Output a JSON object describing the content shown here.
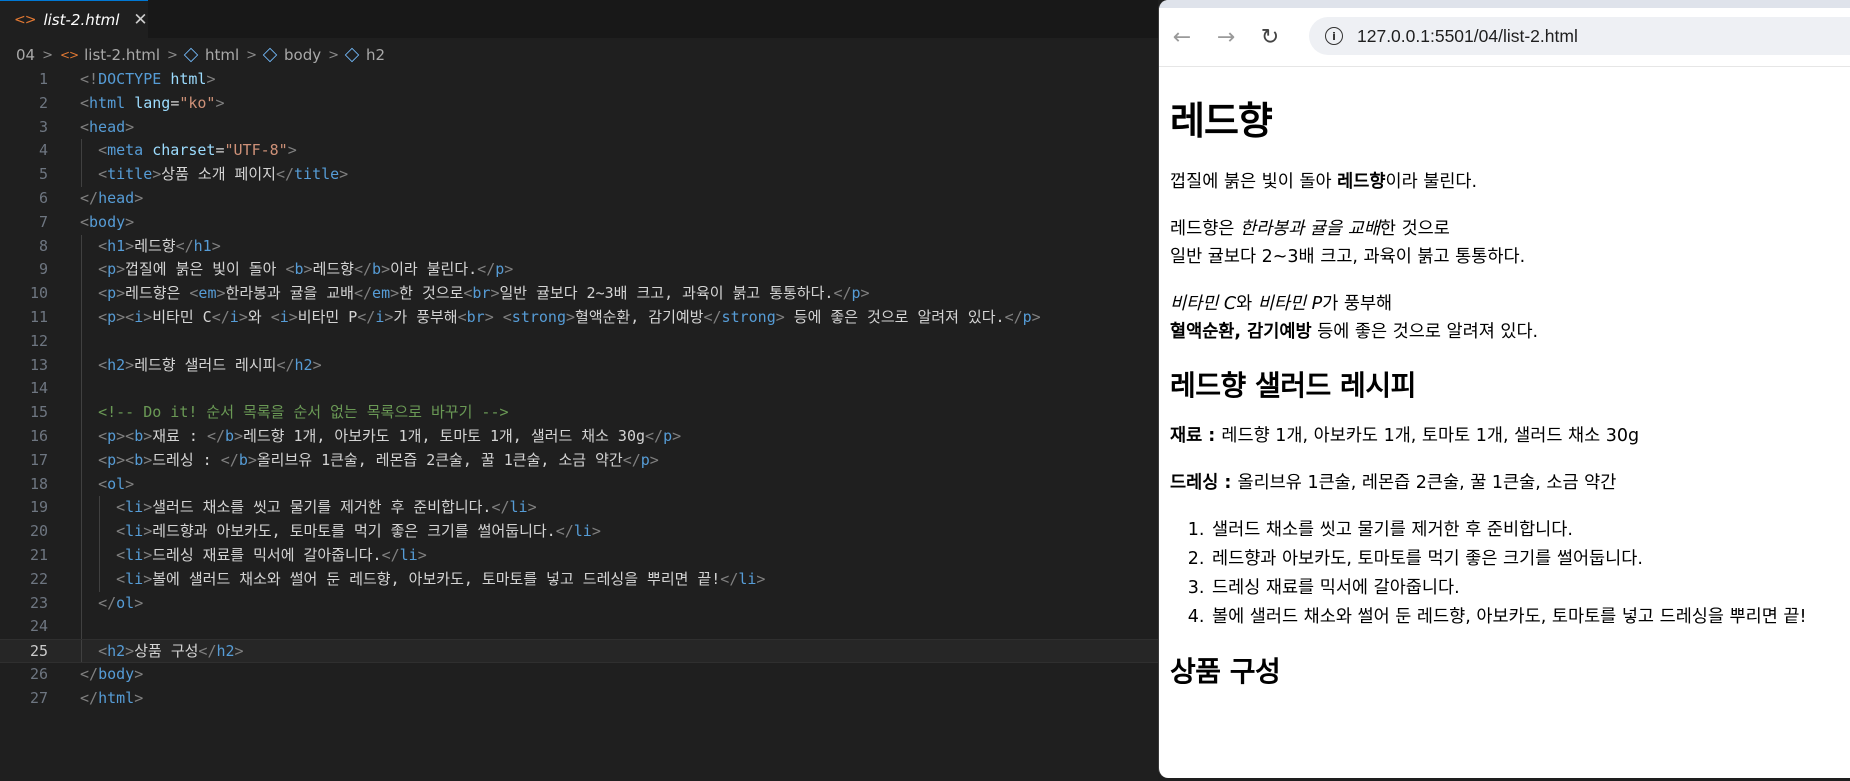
{
  "editor": {
    "tab_icon": "<>",
    "tab_title": "list-2.html",
    "tab_close": "✕",
    "breadcrumb": [
      "04",
      "list-2.html",
      "html",
      "body",
      "h2"
    ],
    "current_line": 25
  },
  "browser": {
    "url": "127.0.0.1:5501/04/list-2.html"
  },
  "page": {
    "h1": "레드향",
    "p1": {
      "a": "껍질에 붉은 빛이 돌아 ",
      "b": "레드향",
      "c": "이라 불린다."
    },
    "p2": {
      "a": "레드향은 ",
      "em": "한라봉과 귤을 교배",
      "b": "한 것으로",
      "c": "일반 귤보다 2~3배 크고, 과육이 붉고 통통하다."
    },
    "p3": {
      "i1": "비타민 C",
      "a": "와 ",
      "i2": "비타민 P",
      "b": "가 풍부해",
      "strong": "혈액순환, 감기예방",
      "c": " 등에 좋은 것으로 알려져 있다."
    },
    "h2_recipe": "레드향 샐러드 레시피",
    "p4": {
      "b": "재료 : ",
      "t": "레드향 1개, 아보카도 1개, 토마토 1개, 샐러드 채소 30g"
    },
    "p5": {
      "b": "드레싱 : ",
      "t": "올리브유 1큰술, 레몬즙 2큰술, 꿀 1큰술, 소금 약간"
    },
    "steps": [
      "샐러드 채소를 씻고 물기를 제거한 후 준비합니다.",
      "레드향과 아보카도, 토마토를 먹기 좋은 크기를 썰어둡니다.",
      "드레싱 재료를 믹서에 갈아줍니다.",
      "볼에 샐러드 채소와 썰어 둔 레드향, 아보카도, 토마토를 넣고 드레싱을 뿌리면 끝!"
    ],
    "h2_composition": "상품 구성"
  },
  "code_lines": [
    [
      [
        "tg",
        "<!"
      ],
      [
        "tn",
        "DOCTYPE"
      ],
      [
        "tx",
        " "
      ],
      [
        "an",
        "html"
      ],
      [
        "tg",
        ">"
      ]
    ],
    [
      [
        "tg",
        "<"
      ],
      [
        "tn",
        "html"
      ],
      [
        "tx",
        " "
      ],
      [
        "an",
        "lang"
      ],
      [
        "tx",
        "="
      ],
      [
        "av",
        "\"ko\""
      ],
      [
        "tg",
        ">"
      ]
    ],
    [
      [
        "tg",
        "<"
      ],
      [
        "tn",
        "head"
      ],
      [
        "tg",
        ">"
      ]
    ],
    [
      [
        "tx",
        "  "
      ],
      [
        "tg",
        "<"
      ],
      [
        "tn",
        "meta"
      ],
      [
        "tx",
        " "
      ],
      [
        "an",
        "charset"
      ],
      [
        "tx",
        "="
      ],
      [
        "av",
        "\"UTF-8\""
      ],
      [
        "tg",
        ">"
      ]
    ],
    [
      [
        "tx",
        "  "
      ],
      [
        "tg",
        "<"
      ],
      [
        "tn",
        "title"
      ],
      [
        "tg",
        ">"
      ],
      [
        "tx",
        "상품 소개 페이지"
      ],
      [
        "tg",
        "</"
      ],
      [
        "tn",
        "title"
      ],
      [
        "tg",
        ">"
      ]
    ],
    [
      [
        "tg",
        "</"
      ],
      [
        "tn",
        "head"
      ],
      [
        "tg",
        ">"
      ]
    ],
    [
      [
        "tg",
        "<"
      ],
      [
        "tn",
        "body"
      ],
      [
        "tg",
        ">"
      ]
    ],
    [
      [
        "tx",
        "  "
      ],
      [
        "tg",
        "<"
      ],
      [
        "tn",
        "h1"
      ],
      [
        "tg",
        ">"
      ],
      [
        "tx",
        "레드향"
      ],
      [
        "tg",
        "</"
      ],
      [
        "tn",
        "h1"
      ],
      [
        "tg",
        ">"
      ]
    ],
    [
      [
        "tx",
        "  "
      ],
      [
        "tg",
        "<"
      ],
      [
        "tn",
        "p"
      ],
      [
        "tg",
        ">"
      ],
      [
        "tx",
        "껍질에 붉은 빛이 돌아 "
      ],
      [
        "tg",
        "<"
      ],
      [
        "tn",
        "b"
      ],
      [
        "tg",
        ">"
      ],
      [
        "tx",
        "레드향"
      ],
      [
        "tg",
        "</"
      ],
      [
        "tn",
        "b"
      ],
      [
        "tg",
        ">"
      ],
      [
        "tx",
        "이라 불린다."
      ],
      [
        "tg",
        "</"
      ],
      [
        "tn",
        "p"
      ],
      [
        "tg",
        ">"
      ]
    ],
    [
      [
        "tx",
        "  "
      ],
      [
        "tg",
        "<"
      ],
      [
        "tn",
        "p"
      ],
      [
        "tg",
        ">"
      ],
      [
        "tx",
        "레드향은 "
      ],
      [
        "tg",
        "<"
      ],
      [
        "tn",
        "em"
      ],
      [
        "tg",
        ">"
      ],
      [
        "tx",
        "한라봉과 귤을 교배"
      ],
      [
        "tg",
        "</"
      ],
      [
        "tn",
        "em"
      ],
      [
        "tg",
        ">"
      ],
      [
        "tx",
        "한 것으로"
      ],
      [
        "tg",
        "<"
      ],
      [
        "tn",
        "br"
      ],
      [
        "tg",
        ">"
      ],
      [
        "tx",
        "일반 귤보다 2~3배 크고, 과육이 붉고 통통하다."
      ],
      [
        "tg",
        "</"
      ],
      [
        "tn",
        "p"
      ],
      [
        "tg",
        ">"
      ]
    ],
    [
      [
        "tx",
        "  "
      ],
      [
        "tg",
        "<"
      ],
      [
        "tn",
        "p"
      ],
      [
        "tg",
        "><"
      ],
      [
        "tn",
        "i"
      ],
      [
        "tg",
        ">"
      ],
      [
        "tx",
        "비타민 C"
      ],
      [
        "tg",
        "</"
      ],
      [
        "tn",
        "i"
      ],
      [
        "tg",
        ">"
      ],
      [
        "tx",
        "와 "
      ],
      [
        "tg",
        "<"
      ],
      [
        "tn",
        "i"
      ],
      [
        "tg",
        ">"
      ],
      [
        "tx",
        "비타민 P"
      ],
      [
        "tg",
        "</"
      ],
      [
        "tn",
        "i"
      ],
      [
        "tg",
        ">"
      ],
      [
        "tx",
        "가 풍부해"
      ],
      [
        "tg",
        "<"
      ],
      [
        "tn",
        "br"
      ],
      [
        "tg",
        ">"
      ],
      [
        "tx",
        " "
      ],
      [
        "tg",
        "<"
      ],
      [
        "tn",
        "strong"
      ],
      [
        "tg",
        ">"
      ],
      [
        "tx",
        "혈액순환, 감기예방"
      ],
      [
        "tg",
        "</"
      ],
      [
        "tn",
        "strong"
      ],
      [
        "tg",
        ">"
      ],
      [
        "tx",
        " 등에 좋은 것으로 알려져 있다."
      ],
      [
        "tg",
        "</"
      ],
      [
        "tn",
        "p"
      ],
      [
        "tg",
        ">"
      ]
    ],
    [],
    [
      [
        "tx",
        "  "
      ],
      [
        "tg",
        "<"
      ],
      [
        "tn",
        "h2"
      ],
      [
        "tg",
        ">"
      ],
      [
        "tx",
        "레드향 샐러드 레시피"
      ],
      [
        "tg",
        "</"
      ],
      [
        "tn",
        "h2"
      ],
      [
        "tg",
        ">"
      ]
    ],
    [],
    [
      [
        "tx",
        "  "
      ],
      [
        "cm",
        "<!-- Do it! 순서 목록을 순서 없는 목록으로 바꾸기 -->"
      ]
    ],
    [
      [
        "tx",
        "  "
      ],
      [
        "tg",
        "<"
      ],
      [
        "tn",
        "p"
      ],
      [
        "tg",
        "><"
      ],
      [
        "tn",
        "b"
      ],
      [
        "tg",
        ">"
      ],
      [
        "tx",
        "재료 : "
      ],
      [
        "tg",
        "</"
      ],
      [
        "tn",
        "b"
      ],
      [
        "tg",
        ">"
      ],
      [
        "tx",
        "레드향 1개, 아보카도 1개, 토마토 1개, 샐러드 채소 30g"
      ],
      [
        "tg",
        "</"
      ],
      [
        "tn",
        "p"
      ],
      [
        "tg",
        ">"
      ]
    ],
    [
      [
        "tx",
        "  "
      ],
      [
        "tg",
        "<"
      ],
      [
        "tn",
        "p"
      ],
      [
        "tg",
        "><"
      ],
      [
        "tn",
        "b"
      ],
      [
        "tg",
        ">"
      ],
      [
        "tx",
        "드레싱 : "
      ],
      [
        "tg",
        "</"
      ],
      [
        "tn",
        "b"
      ],
      [
        "tg",
        ">"
      ],
      [
        "tx",
        "올리브유 1큰술, 레몬즙 2큰술, 꿀 1큰술, 소금 약간"
      ],
      [
        "tg",
        "</"
      ],
      [
        "tn",
        "p"
      ],
      [
        "tg",
        ">"
      ]
    ],
    [
      [
        "tx",
        "  "
      ],
      [
        "tg",
        "<"
      ],
      [
        "tn",
        "ol"
      ],
      [
        "tg",
        ">"
      ]
    ],
    [
      [
        "tx",
        "    "
      ],
      [
        "tg",
        "<"
      ],
      [
        "tn",
        "li"
      ],
      [
        "tg",
        ">"
      ],
      [
        "tx",
        "샐러드 채소를 씻고 물기를 제거한 후 준비합니다."
      ],
      [
        "tg",
        "</"
      ],
      [
        "tn",
        "li"
      ],
      [
        "tg",
        ">"
      ]
    ],
    [
      [
        "tx",
        "    "
      ],
      [
        "tg",
        "<"
      ],
      [
        "tn",
        "li"
      ],
      [
        "tg",
        ">"
      ],
      [
        "tx",
        "레드향과 아보카도, 토마토를 먹기 좋은 크기를 썰어둡니다."
      ],
      [
        "tg",
        "</"
      ],
      [
        "tn",
        "li"
      ],
      [
        "tg",
        ">"
      ]
    ],
    [
      [
        "tx",
        "    "
      ],
      [
        "tg",
        "<"
      ],
      [
        "tn",
        "li"
      ],
      [
        "tg",
        ">"
      ],
      [
        "tx",
        "드레싱 재료를 믹서에 갈아줍니다."
      ],
      [
        "tg",
        "</"
      ],
      [
        "tn",
        "li"
      ],
      [
        "tg",
        ">"
      ]
    ],
    [
      [
        "tx",
        "    "
      ],
      [
        "tg",
        "<"
      ],
      [
        "tn",
        "li"
      ],
      [
        "tg",
        ">"
      ],
      [
        "tx",
        "볼에 샐러드 채소와 썰어 둔 레드향, 아보카도, 토마토를 넣고 드레싱을 뿌리면 끝!"
      ],
      [
        "tg",
        "</"
      ],
      [
        "tn",
        "li"
      ],
      [
        "tg",
        ">"
      ]
    ],
    [
      [
        "tx",
        "  "
      ],
      [
        "tg",
        "</"
      ],
      [
        "tn",
        "ol"
      ],
      [
        "tg",
        ">"
      ]
    ],
    [],
    [
      [
        "tx",
        "  "
      ],
      [
        "tg",
        "<"
      ],
      [
        "tn",
        "h2"
      ],
      [
        "tg",
        ">"
      ],
      [
        "tx",
        "상품 구성"
      ],
      [
        "tg",
        "</"
      ],
      [
        "tn",
        "h2"
      ],
      [
        "tg",
        ">"
      ]
    ],
    [
      [
        "tg",
        "</"
      ],
      [
        "tn",
        "body"
      ],
      [
        "tg",
        ">"
      ]
    ],
    [
      [
        "tg",
        "</"
      ],
      [
        "tn",
        "html"
      ],
      [
        "tg",
        ">"
      ]
    ]
  ]
}
